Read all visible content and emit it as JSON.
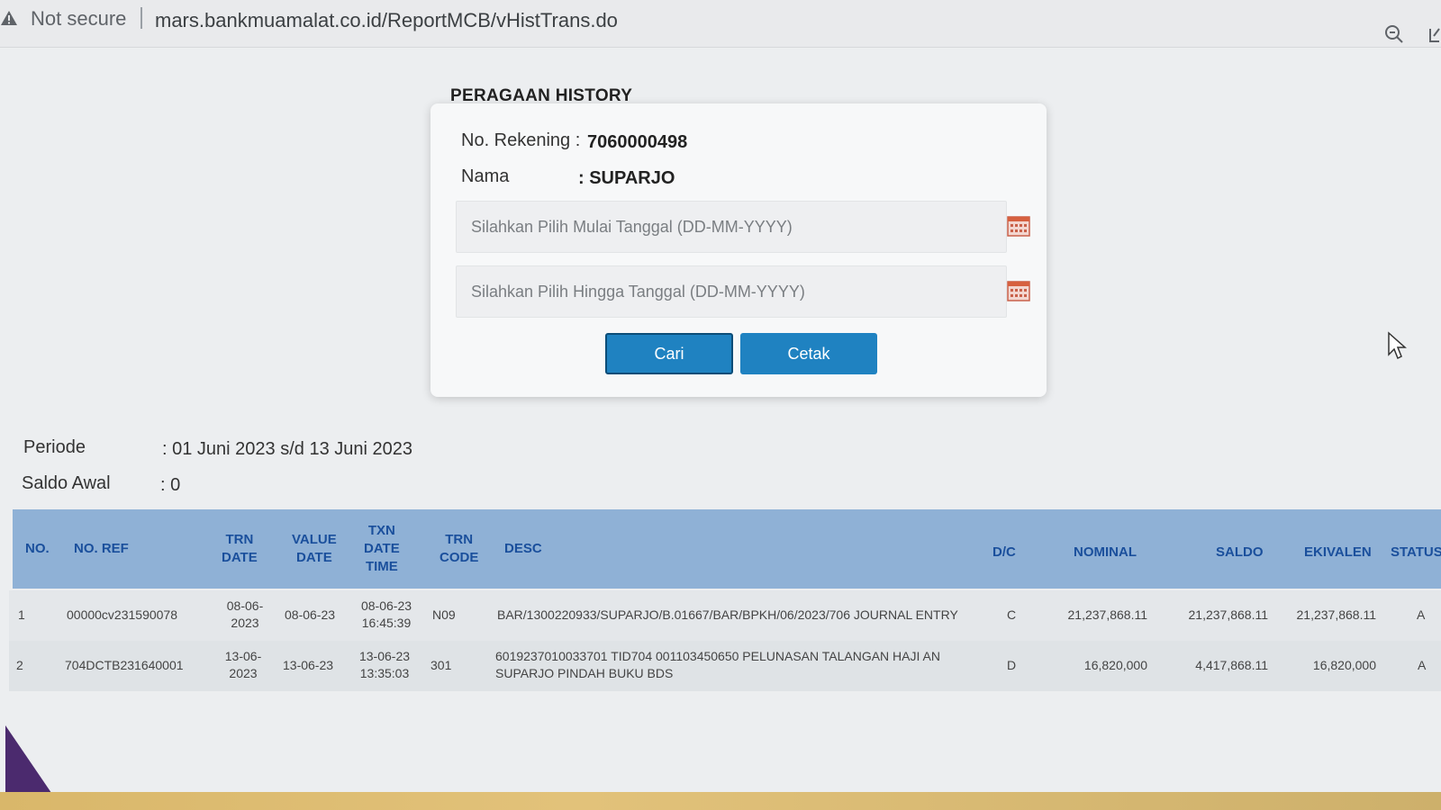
{
  "browser": {
    "security_label": "Not secure",
    "url": "mars.bankmuamalat.co.id/ReportMCB/vHistTrans.do"
  },
  "modal": {
    "title": "PERAGAAN HISTORY",
    "account_label": "No. Rekening :",
    "account_value": "7060000498",
    "name_label": "Nama",
    "name_value": ": SUPARJO",
    "start_date_placeholder": "Silahkan Pilih Mulai Tanggal (DD-MM-YYYY)",
    "end_date_placeholder": "Silahkan Pilih Hingga Tanggal (DD-MM-YYYY)",
    "search_button": "Cari",
    "print_button": "Cetak"
  },
  "summary": {
    "period_label": "Periode",
    "period_value": ": 01 Juni 2023 s/d 13 Juni 2023",
    "opening_label": "Saldo Awal",
    "opening_value": ": 0"
  },
  "table": {
    "headers": {
      "no": "NO.",
      "ref": "NO. REF",
      "trn_date_1": "TRN",
      "trn_date_2": "DATE",
      "value_date_1": "VALUE",
      "value_date_2": "DATE",
      "txn_dt_1": "TXN",
      "txn_dt_2": "DATE",
      "txn_dt_3": "TIME",
      "trn_code_1": "TRN",
      "trn_code_2": "CODE",
      "desc": "DESC",
      "dc": "D/C",
      "nominal": "NOMINAL",
      "saldo": "SALDO",
      "ekivalen": "EKIVALEN",
      "status": "STATUS"
    },
    "rows": [
      {
        "no": "1",
        "ref": "00000cv231590078",
        "trn_date_1": "08-06-",
        "trn_date_2": "2023",
        "value_date": "08-06-23",
        "txn_date": "08-06-23",
        "txn_time": "16:45:39",
        "trn_code": "N09",
        "desc_1": "BAR/1300220933/SUPARJO/B.01667/BAR/BPKH/06/2023/706 JOURNAL ENTRY",
        "desc_2": "",
        "dc": "C",
        "nominal": "21,237,868.11",
        "saldo": "21,237,868.11",
        "ekivalen": "21,237,868.11",
        "status": "A"
      },
      {
        "no": "2",
        "ref": "704DCTB231640001",
        "trn_date_1": "13-06-",
        "trn_date_2": "2023",
        "value_date": "13-06-23",
        "txn_date": "13-06-23",
        "txn_time": "13:35:03",
        "trn_code": "301",
        "desc_1": "6019237010033701 TID704 001103450650 PELUNASAN TALANGAN HAJI AN",
        "desc_2": "SUPARJO PINDAH BUKU BDS",
        "dc": "D",
        "nominal": "16,820,000",
        "saldo": "4,417,868.11",
        "ekivalen": "16,820,000",
        "status": "A"
      }
    ]
  },
  "icons": {
    "warning": "warning-triangle-icon",
    "zoom": "zoom-icon",
    "calendar": "calendar-icon",
    "cursor": "mouse-pointer-icon"
  },
  "colors": {
    "button": "#1f82c1",
    "table_header": "#8fb1d6",
    "header_text": "#1a4f9c"
  }
}
